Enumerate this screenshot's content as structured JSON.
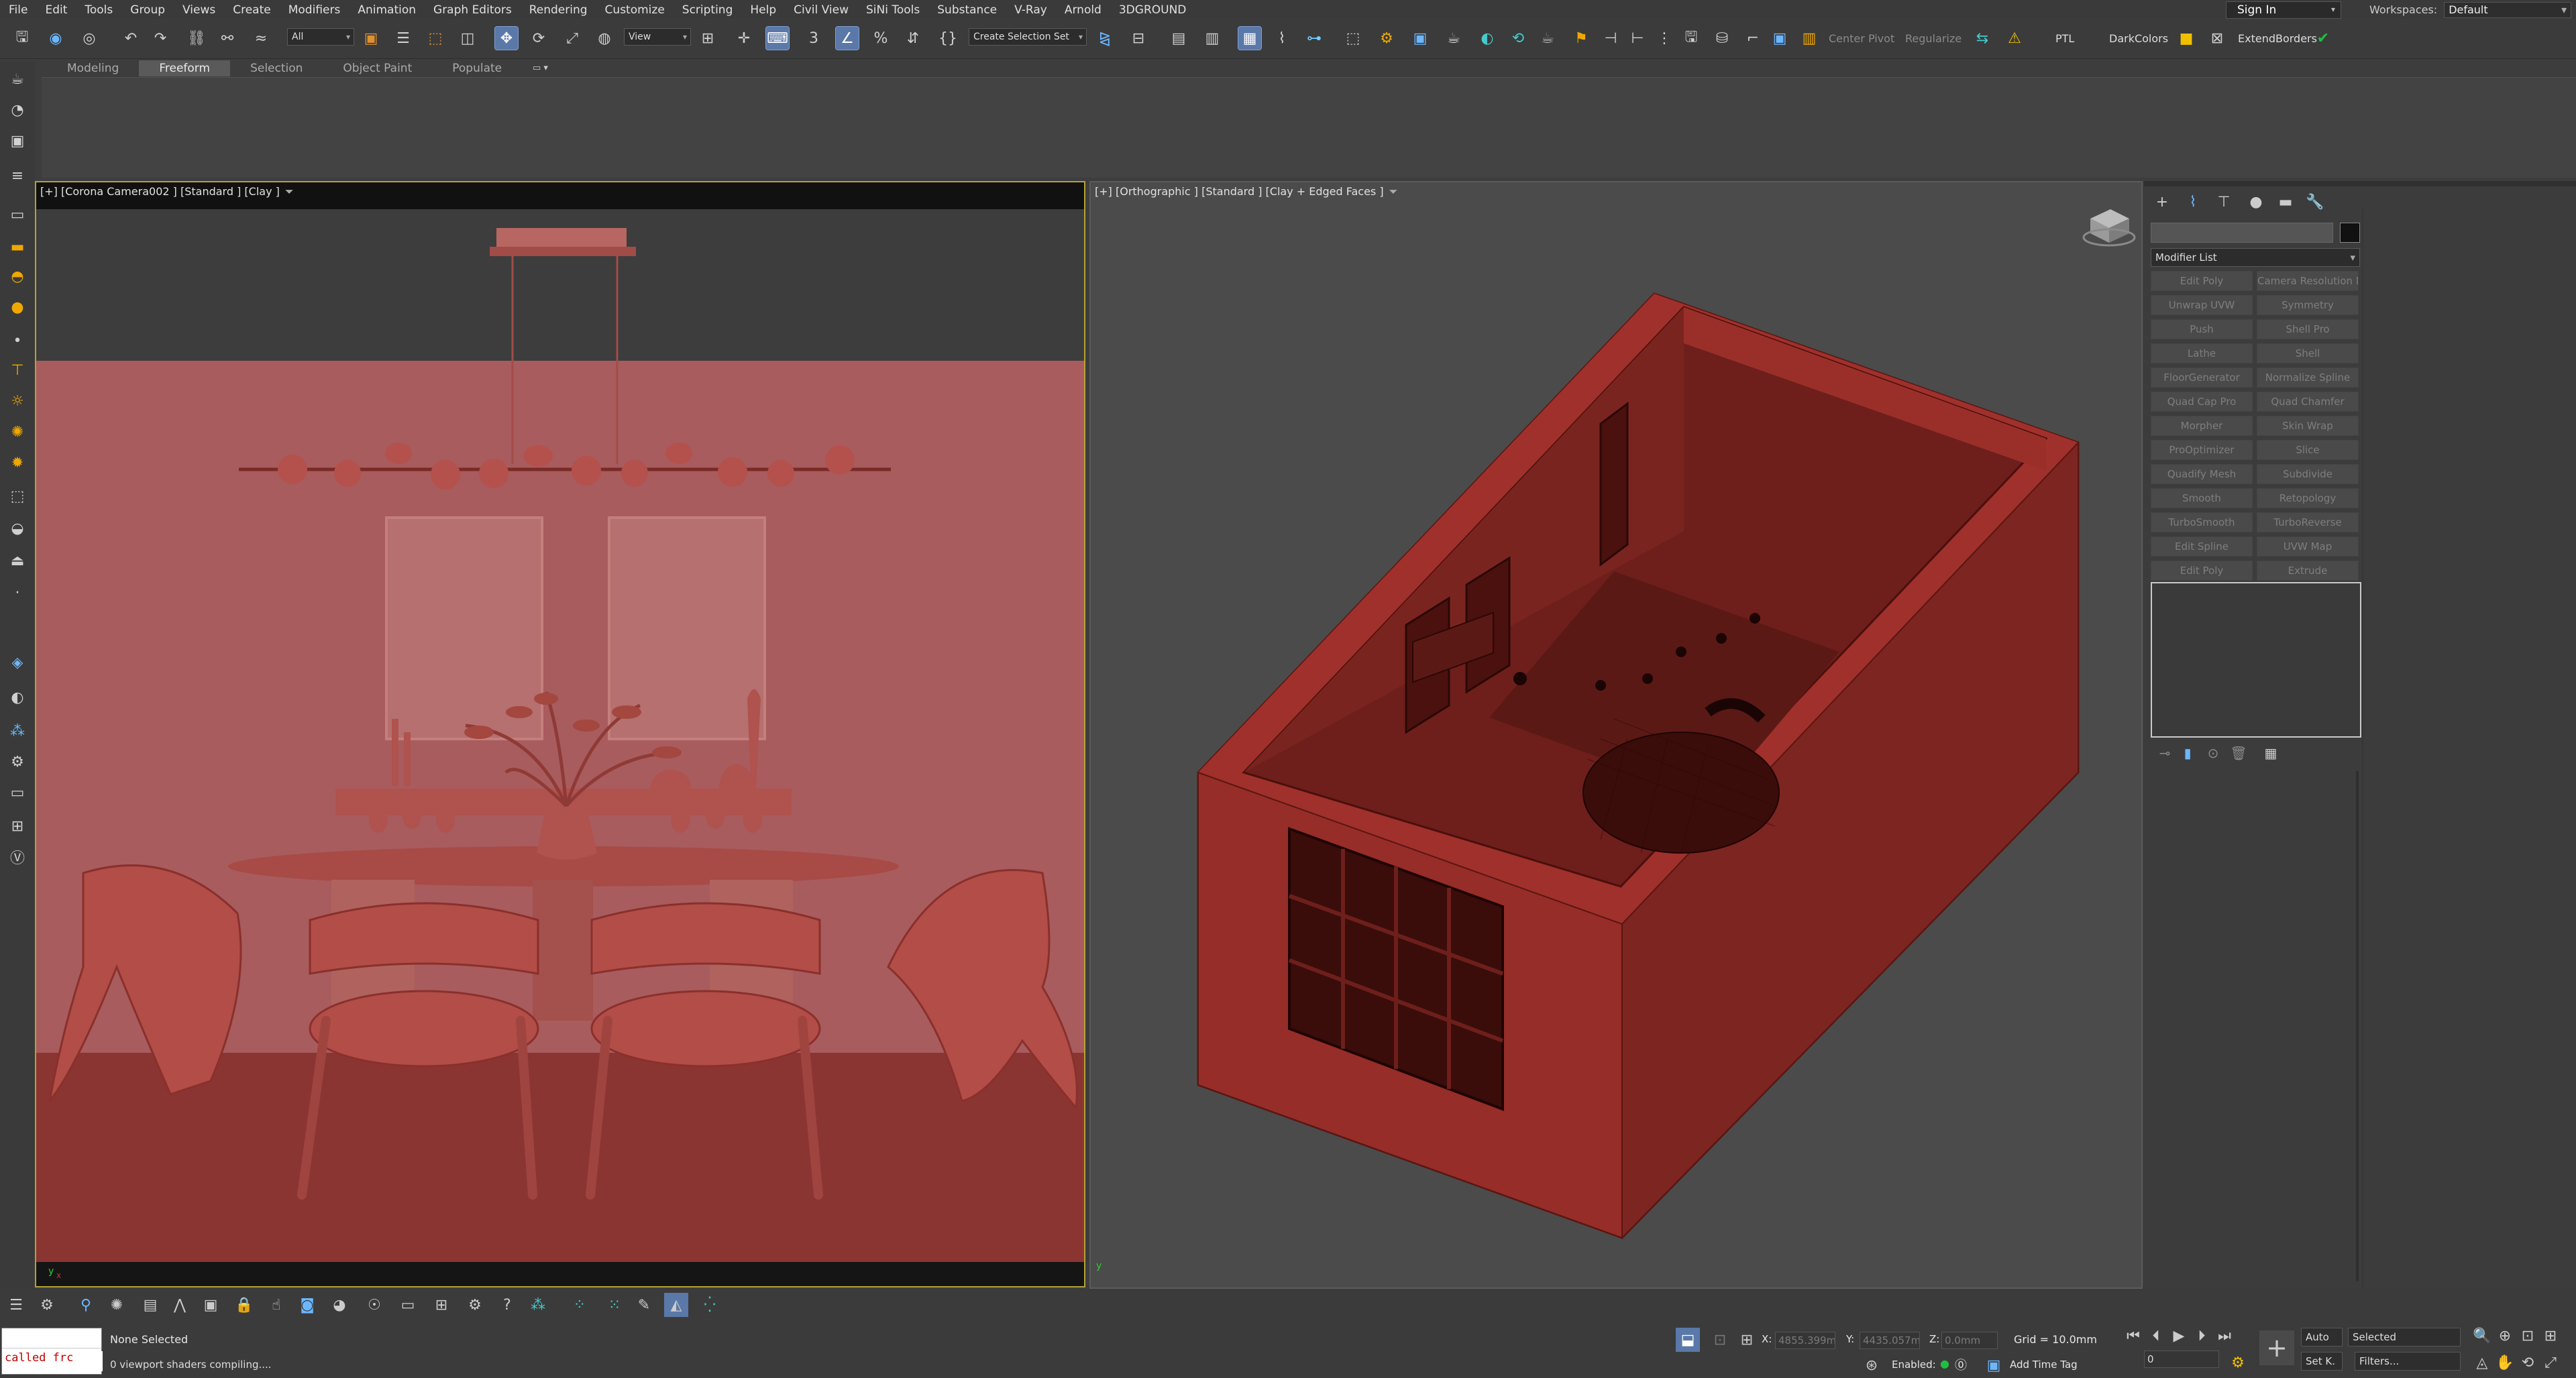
{
  "menu": [
    "File",
    "Edit",
    "Tools",
    "Group",
    "Views",
    "Create",
    "Modifiers",
    "Animation",
    "Graph Editors",
    "Rendering",
    "Customize",
    "Scripting",
    "Help",
    "Civil View",
    "SiNi Tools",
    "Substance",
    "V-Ray",
    "Arnold",
    "3DGROUND"
  ],
  "account": {
    "sign_in": "Sign In",
    "workspaces_label": "Workspaces:",
    "workspace_value": "Default"
  },
  "toolbar": {
    "filter_value": "All",
    "ref_coord_value": "View",
    "selection_set_value": "Create Selection Set",
    "center_pivot": "Center Pivot",
    "regularize": "Regularize",
    "ptl": "PTL",
    "dark_colors": "DarkColors",
    "extend_borders": "ExtendBorders"
  },
  "ribbon": {
    "tabs": [
      "Modeling",
      "Freeform",
      "Selection",
      "Object Paint",
      "Populate"
    ],
    "active_tab": "Freeform"
  },
  "viewports": {
    "left": {
      "label": "[+] [Corona Camera002 ] [Standard ] [Clay ]"
    },
    "right": {
      "label": "[+] [Orthographic ] [Standard ] [Clay + Edged Faces ]"
    }
  },
  "command_panel": {
    "modifier_list": "Modifier List",
    "modifiers": [
      "Edit Poly",
      "Camera Resolution M",
      "Unwrap UVW",
      "Symmetry",
      "Push",
      "Shell Pro",
      "Lathe",
      "Shell",
      "FloorGenerator",
      "Normalize Spline",
      "Quad Cap Pro",
      "Quad Chamfer",
      "Morpher",
      "Skin Wrap",
      "ProOptimizer",
      "Slice",
      "Quadify Mesh",
      "Subdivide",
      "Smooth",
      "Retopology",
      "TurboSmooth",
      "TurboReverse",
      "Edit Spline",
      "UVW Map",
      "Edit Poly",
      "Extrude"
    ]
  },
  "status": {
    "maxscript_error": "called frc",
    "selection": "None Selected",
    "prompt": "0 viewport shaders compiling....",
    "x_label": "X:",
    "x_value": "4855.399m",
    "y_label": "Y:",
    "y_value": "4435.057m",
    "z_label": "Z:",
    "z_value": "0.0mm",
    "grid": "Grid = 10.0mm",
    "enabled_label": "Enabled:",
    "add_time_tag": "Add Time Tag",
    "auto": "Auto",
    "set_k": "Set K.",
    "selected_value": "Selected",
    "filters": "Filters...",
    "frame_value": "0"
  },
  "colors": {
    "clay": "#b45a56",
    "clay_dark": "#7a2a26",
    "room_red": "#8a2a26",
    "accent_blue": "#5a78a8",
    "active_border": "#b6a235"
  }
}
